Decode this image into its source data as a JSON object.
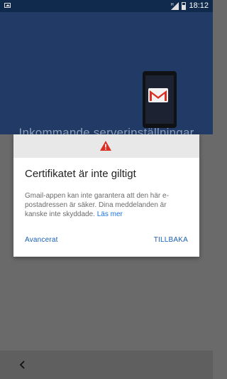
{
  "status": {
    "time": "18:12",
    "icons": [
      "gallery-icon",
      "signal-icon",
      "battery-icon"
    ]
  },
  "header": {
    "title": "Inkommande serverinställningar",
    "illustration": "phone-gmail-icon"
  },
  "dialog": {
    "icon": "warning-icon",
    "title": "Certifikatet är inte giltigt",
    "body": "Gmail-appen kan inte garantera att den här e-postadressen är säker. Dina meddelanden är kanske inte skyddade.",
    "learn_more": "Läs mer",
    "advanced_label": "Avancerat",
    "back_label": "TILLBAKA"
  },
  "navbar": {
    "back_icon": "chevron-left-icon"
  },
  "colors": {
    "statusbar": "#102a4d",
    "hero": "#213b66",
    "overlay": "#6a6a6a",
    "accent": "#1a5fb4",
    "warning": "#d93025"
  }
}
